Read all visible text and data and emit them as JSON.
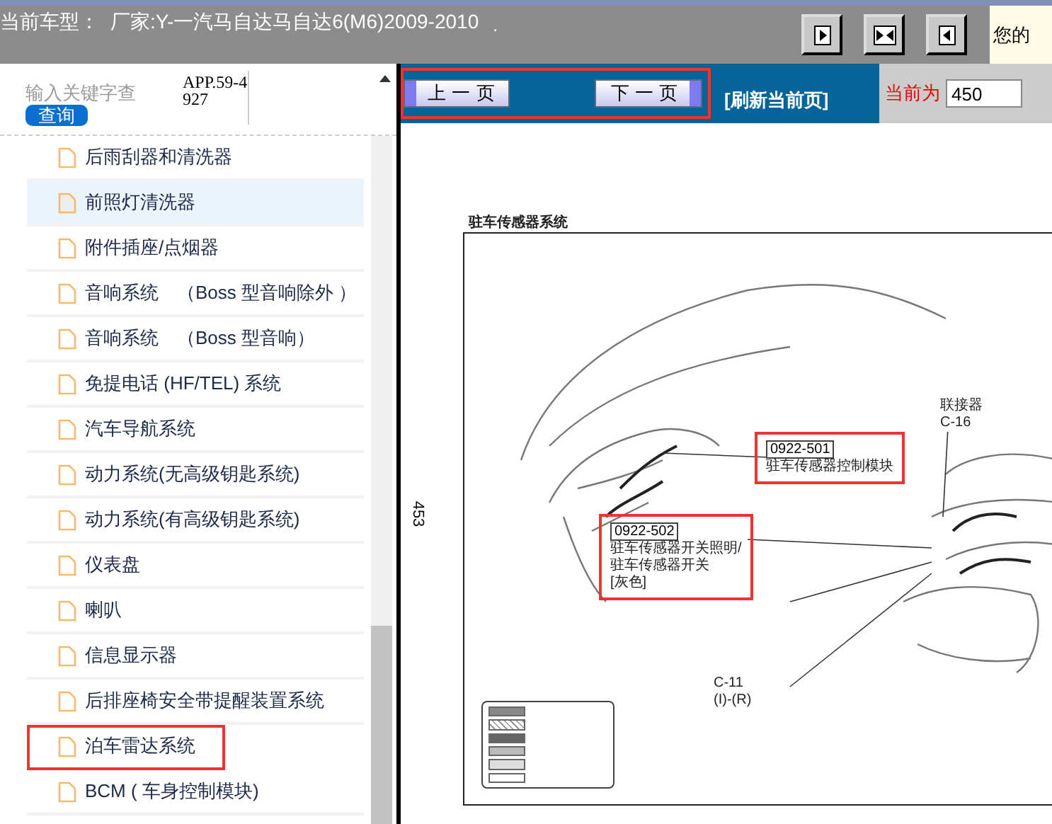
{
  "header": {
    "car_model_label": "当前车型：",
    "car_model": "厂家:Y-一汽马自达马自达6(M6)2009-2010",
    "marker": ".",
    "user_text": "您的"
  },
  "search": {
    "placeholder": "输入关键字查",
    "button": "查询",
    "app_code": "APP.59-4927"
  },
  "tree": [
    {
      "label": "后雨刮器和清洗器",
      "selected": false,
      "annotated": false
    },
    {
      "label": "前照灯清洗器",
      "selected": true,
      "annotated": false
    },
    {
      "label": "附件插座/点烟器",
      "selected": false,
      "annotated": false
    },
    {
      "label": "音响系统　（Boss 型音响除外 ）",
      "selected": false,
      "annotated": false
    },
    {
      "label": "音响系统　（Boss 型音响）",
      "selected": false,
      "annotated": false
    },
    {
      "label": "免提电话 (HF/TEL) 系统",
      "selected": false,
      "annotated": false
    },
    {
      "label": "汽车导航系统",
      "selected": false,
      "annotated": false
    },
    {
      "label": "动力系统(无高级钥匙系统)",
      "selected": false,
      "annotated": false
    },
    {
      "label": "动力系统(有高级钥匙系统)",
      "selected": false,
      "annotated": false
    },
    {
      "label": "仪表盘",
      "selected": false,
      "annotated": false
    },
    {
      "label": "喇叭",
      "selected": false,
      "annotated": false
    },
    {
      "label": "信息显示器",
      "selected": false,
      "annotated": false
    },
    {
      "label": "后排座椅安全带提醒装置系统",
      "selected": false,
      "annotated": false
    },
    {
      "label": "泊车雷达系统",
      "selected": false,
      "annotated": true
    },
    {
      "label": "BCM ( 车身控制模块)",
      "selected": false,
      "annotated": false
    }
  ],
  "pager": {
    "prev": "上 一 页",
    "next": "下 一 页",
    "annotated": true,
    "refresh": "[刷新当前页]",
    "current_label": "当前为",
    "current_value": "450"
  },
  "document": {
    "page_number": "453",
    "title": "驻车传感器系统",
    "callouts": [
      {
        "code": "0922-501",
        "lines": [
          "驻车传感器控制模块"
        ],
        "annotated": true
      },
      {
        "lines": [
          "联接器",
          "C-16"
        ]
      },
      {
        "code": "0922-502",
        "lines": [
          "驻车传感器开关照明/",
          "驻车传感器开关",
          "[灰色]"
        ],
        "annotated": true
      },
      {
        "lines": [
          "C-11",
          "(I)-(R)"
        ]
      }
    ]
  }
}
